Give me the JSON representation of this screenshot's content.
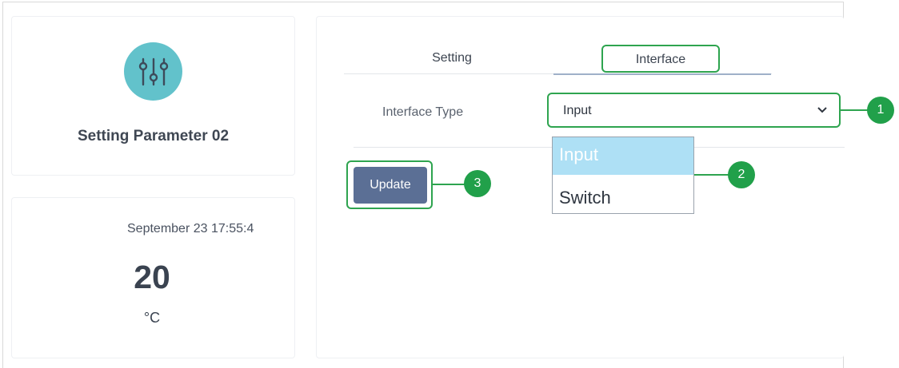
{
  "device": {
    "icon": "sliders-icon",
    "title": "Setting Parameter 02",
    "icon_color": "#62c2cb"
  },
  "reading": {
    "datetime": "September 23 17:55:4",
    "value": "20",
    "unit": "°C"
  },
  "tabs": [
    {
      "label": "Setting",
      "active": false
    },
    {
      "label": "Interface",
      "active": true
    }
  ],
  "form": {
    "interface_type_label": "Interface Type",
    "interface_type_value": "Input",
    "options": [
      "Input",
      "Switch"
    ],
    "update_label": "Update"
  },
  "callouts": [
    "1",
    "2",
    "3"
  ],
  "colors": {
    "highlight": "#2ea44f",
    "badge": "#21a04a",
    "button": "#5b6f95",
    "option_selected": "#aee0f5"
  }
}
